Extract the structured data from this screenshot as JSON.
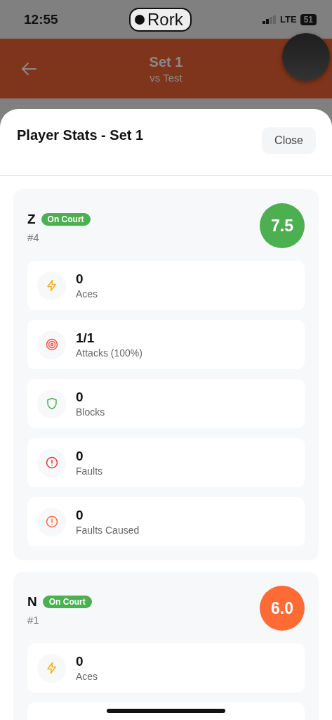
{
  "status_bar": {
    "time": "12:55",
    "app_pill": "Rork",
    "network": "LTE",
    "battery": "51"
  },
  "header": {
    "title": "Set 1",
    "subtitle": "vs Test"
  },
  "sheet": {
    "title": "Player Stats - Set 1",
    "close": "Close"
  },
  "players": [
    {
      "name": "Z",
      "badge": "On Court",
      "number": "#4",
      "rating": "7.5",
      "color": "#4caf50",
      "stats": [
        {
          "kind": "bolt",
          "value": "0",
          "label": "Aces"
        },
        {
          "kind": "target",
          "value": "1/1",
          "label": "Attacks (100%)"
        },
        {
          "kind": "shield",
          "value": "0",
          "label": "Blocks"
        },
        {
          "kind": "alert",
          "value": "0",
          "label": "Faults"
        },
        {
          "kind": "alert-soft",
          "value": "0",
          "label": "Faults Caused"
        }
      ]
    },
    {
      "name": "N",
      "badge": "On Court",
      "number": "#1",
      "rating": "6.0",
      "color": "#ff6b35",
      "stats": [
        {
          "kind": "bolt",
          "value": "0",
          "label": "Aces"
        }
      ]
    }
  ]
}
